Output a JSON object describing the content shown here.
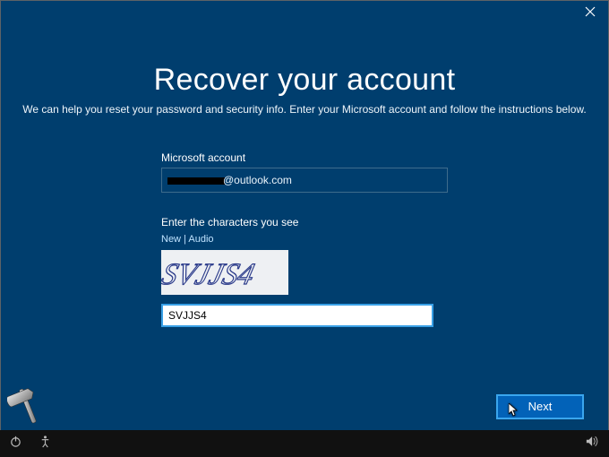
{
  "titlebar": {
    "close_tooltip": "Close"
  },
  "page": {
    "title": "Recover your account",
    "subtitle": "We can help you reset your password and security info. Enter your Microsoft account and follow the instructions below."
  },
  "form": {
    "account_label": "Microsoft account",
    "account_value_suffix": "@outlook.com",
    "captcha_label": "Enter the characters you see",
    "new_link": "New",
    "sep": " | ",
    "audio_link": "Audio",
    "captcha_text": "SVJJS4",
    "captcha_input_value": "SVJJS4"
  },
  "buttons": {
    "next": "Next"
  },
  "icons": {
    "power": "power-icon",
    "ease": "ease-of-access-icon",
    "volume": "volume-icon",
    "close": "close-icon",
    "hammer": "hammer-icon"
  }
}
